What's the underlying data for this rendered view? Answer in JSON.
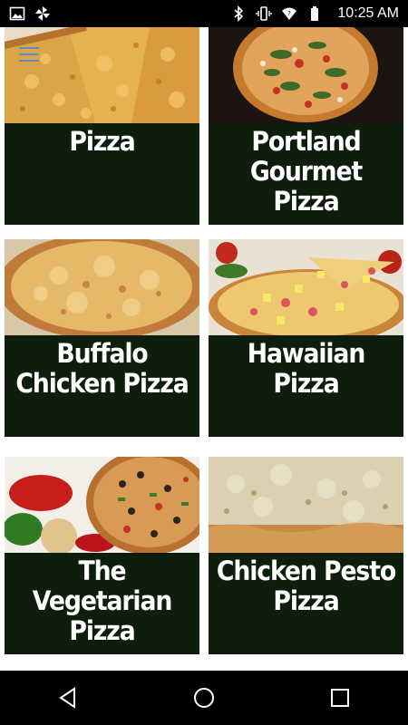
{
  "status_bar": {
    "time": "10:25 AM",
    "left_icons": [
      "image-icon",
      "pinwheel-icon"
    ],
    "right_icons": [
      "bluetooth-icon",
      "vibrate-icon",
      "wifi-icon",
      "battery-icon"
    ]
  },
  "menu": {
    "icon": "hamburger-menu-icon"
  },
  "items": [
    {
      "label": "Pizza"
    },
    {
      "label": "Portland Gourmet Pizza"
    },
    {
      "label": "Buffalo Chicken Pizza"
    },
    {
      "label": "Hawaiian Pizza"
    },
    {
      "label": "The Vegetarian Pizza"
    },
    {
      "label": "Chicken Pesto Pizza"
    }
  ],
  "nav_bar": {
    "buttons": [
      "back-icon",
      "home-icon",
      "recents-icon"
    ]
  },
  "colors": {
    "card_background": "#0d1e0d",
    "title_text": "#ffffff",
    "bars": "#000000",
    "menu_accent": "#5a8fc8"
  }
}
